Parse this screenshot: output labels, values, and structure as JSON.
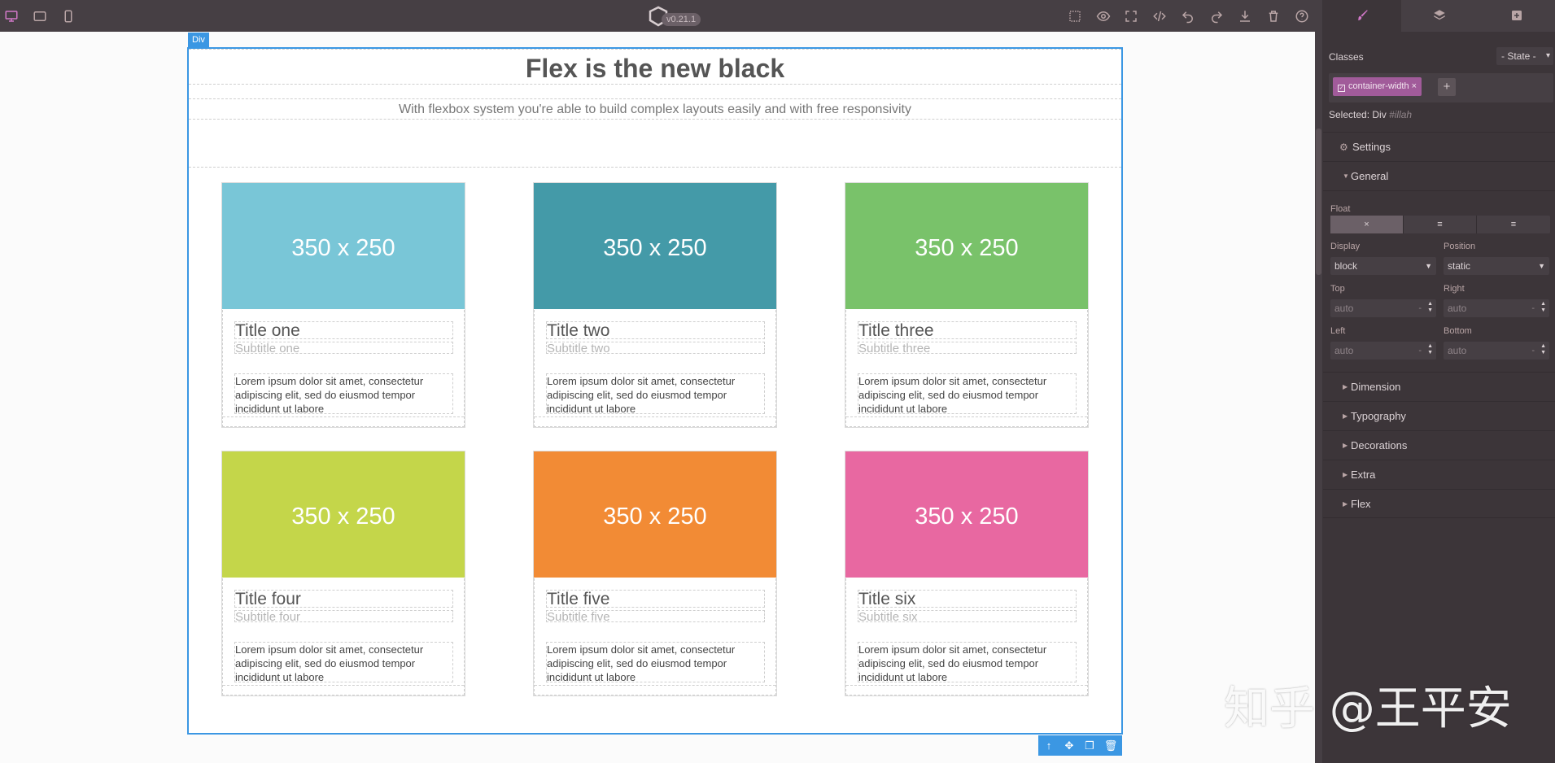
{
  "topbar": {
    "version": "v0.21.1",
    "devices": [
      "desktop-icon",
      "tablet-icon",
      "mobile-icon"
    ],
    "actions": [
      "sw-visibility-icon",
      "preview-icon",
      "fullscreen-icon",
      "export-code-icon",
      "undo-icon",
      "redo-icon",
      "import-icon",
      "clear-canvas-icon",
      "help-icon"
    ]
  },
  "panel": {
    "tabs": [
      "style-manager-icon",
      "layer-manager-icon",
      "blocks-icon"
    ],
    "classes_label": "Classes",
    "state_select": "- State -",
    "class_tag": "container-width",
    "class_tag_remove": "×",
    "class_add": "+",
    "selected_prefix": "Selected:",
    "selected_name": "Div",
    "selected_id": "#illah",
    "settings_label": "Settings",
    "general_label": "General",
    "float_label": "Float",
    "float_options": [
      "×",
      "≡",
      "≡"
    ],
    "display_label": "Display",
    "display_value": "block",
    "position_label": "Position",
    "position_value": "static",
    "top_label": "Top",
    "top_value": "auto",
    "right_label": "Right",
    "right_value": "auto",
    "left_label": "Left",
    "left_value": "auto",
    "bottom_label": "Bottom",
    "bottom_value": "auto",
    "unit_placeholder": "-",
    "sections": [
      "Dimension",
      "Typography",
      "Decorations",
      "Extra",
      "Flex"
    ]
  },
  "canvas": {
    "selected_badge": "Div",
    "heading": "Flex is the new black",
    "subheading": "With flexbox system you're able to build complex layouts easily and with free responsivity",
    "cards": [
      {
        "image_text": "350 x 250",
        "color": "#79c6d7",
        "title": "Title one",
        "subtitle": "Subtitle one",
        "text": "Lorem ipsum dolor sit amet, consectetur adipiscing elit, sed do eiusmod tempor incididunt ut labore"
      },
      {
        "image_text": "350 x 250",
        "color": "#449aa8",
        "title": "Title two",
        "subtitle": "Subtitle two",
        "text": "Lorem ipsum dolor sit amet, consectetur adipiscing elit, sed do eiusmod tempor incididunt ut labore"
      },
      {
        "image_text": "350 x 250",
        "color": "#79c26a",
        "title": "Title three",
        "subtitle": "Subtitle three",
        "text": "Lorem ipsum dolor sit amet, consectetur adipiscing elit, sed do eiusmod tempor incididunt ut labore"
      },
      {
        "image_text": "350 x 250",
        "color": "#c4d64a",
        "title": "Title four",
        "subtitle": "Subtitle four",
        "text": "Lorem ipsum dolor sit amet, consectetur adipiscing elit, sed do eiusmod tempor incididunt ut labore"
      },
      {
        "image_text": "350 x 250",
        "color": "#f28b35",
        "title": "Title five",
        "subtitle": "Subtitle five",
        "text": "Lorem ipsum dolor sit amet, consectetur adipiscing elit, sed do eiusmod tempor incididunt ut labore"
      },
      {
        "image_text": "350 x 250",
        "color": "#e868a1",
        "title": "Title six",
        "subtitle": "Subtitle six",
        "text": "Lorem ipsum dolor sit amet, consectetur adipiscing elit, sed do eiusmod tempor incididunt ut labore"
      }
    ],
    "toolbar": [
      "arrow-up-icon",
      "move-icon",
      "clone-icon",
      "delete-icon"
    ]
  },
  "watermark": "知乎 @王平安",
  "colors": {
    "editor_bg": "#463f44",
    "panel_bg": "#3c3539",
    "accent": "#d278c9",
    "selection": "#3b97e3",
    "class_tag": "#a15b9a"
  }
}
